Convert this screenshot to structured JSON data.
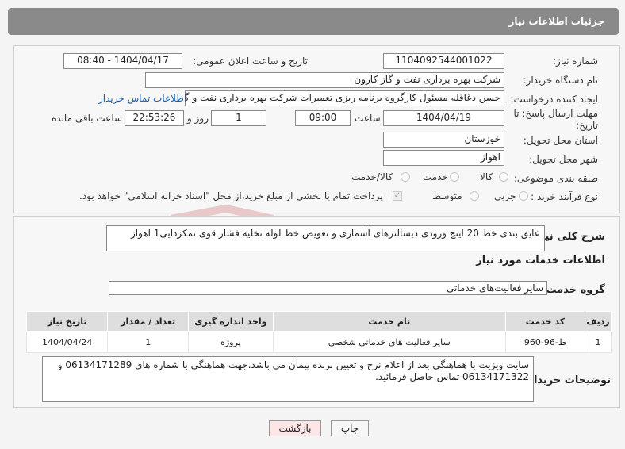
{
  "header": {
    "title": "جزئیات اطلاعات نیاز"
  },
  "form": {
    "need_number_label": "شماره نیاز:",
    "need_number": "1104092544001022",
    "announce_label": "تاریخ و ساعت اعلان عمومی:",
    "announce_value": "1404/04/17 - 08:40",
    "buyer_org_label": "نام دستگاه خریدار:",
    "buyer_org": "شرکت بهره برداری نفت و گاز کارون",
    "creator_label": "ایجاد کننده درخواست:",
    "creator": "حسن دغاقله مسئول کارگروه برنامه ریزی تعمیرات شرکت بهره برداری نفت و گاز کارون",
    "contact_link": "اطلاعات تماس خریدار",
    "deadline_label_1": "مهلت ارسال پاسخ: تا",
    "deadline_label_2": "تاریخ:",
    "deadline_date": "1404/04/19",
    "time_label": "ساعت",
    "deadline_time": "09:00",
    "days_value": "1",
    "days_label": "روز و",
    "remaining_time": "22:53:26",
    "remaining_label": "ساعت باقی مانده",
    "province_label": "استان محل تحویل:",
    "province": "خوزستان",
    "city_label": "شهر محل تحویل:",
    "city": "اهواز",
    "category_label": "طبقه بندی موضوعی:",
    "category_options": [
      "کالا",
      "خدمت",
      "کالا/خدمت"
    ],
    "process_label": "نوع فرآیند خرید :",
    "process_options": [
      "جزیی",
      "متوسط"
    ],
    "payment_note": "پرداخت تمام یا بخشی از مبلغ خرید،از محل \"اسناد خزانه اسلامی\" خواهد بود."
  },
  "need": {
    "summary_label": "شرح کلی نیاز:",
    "summary": "عایق بندی خط 20 اینچ ورودی دیسالترهای آسماری و تعویض خط لوله تخلیه فشار قوی نمکزدایی1 اهواز",
    "services_title": "اطلاعات خدمات مورد نیاز",
    "service_group_label": "گروه خدمت:",
    "service_group": "سایر فعالیت‌های خدماتی"
  },
  "table": {
    "headers": [
      "ردیف",
      "کد خدمت",
      "نام خدمت",
      "واحد اندازه گیری",
      "تعداد / مقدار",
      "تاریخ نیاز"
    ],
    "rows": [
      [
        "1",
        "ط-96-960",
        "سایر فعالیت های خدماتی شخصی",
        "پروژه",
        "1",
        "1404/04/24"
      ]
    ]
  },
  "buyer_notes": {
    "label": "توضیحات خریدار:",
    "text": "سایت ویزیت با هماهنگی بعد از اعلام نرخ و تعیین برنده پیمان می باشد.جهت هماهنگی با شماره های  06134171289 و 06134171322 تماس حاصل فرمائید."
  },
  "buttons": {
    "print": "چاپ",
    "back": "بازگشت"
  },
  "watermark": {
    "text": "AriaTender.net",
    "color": "#e8c8c8"
  }
}
